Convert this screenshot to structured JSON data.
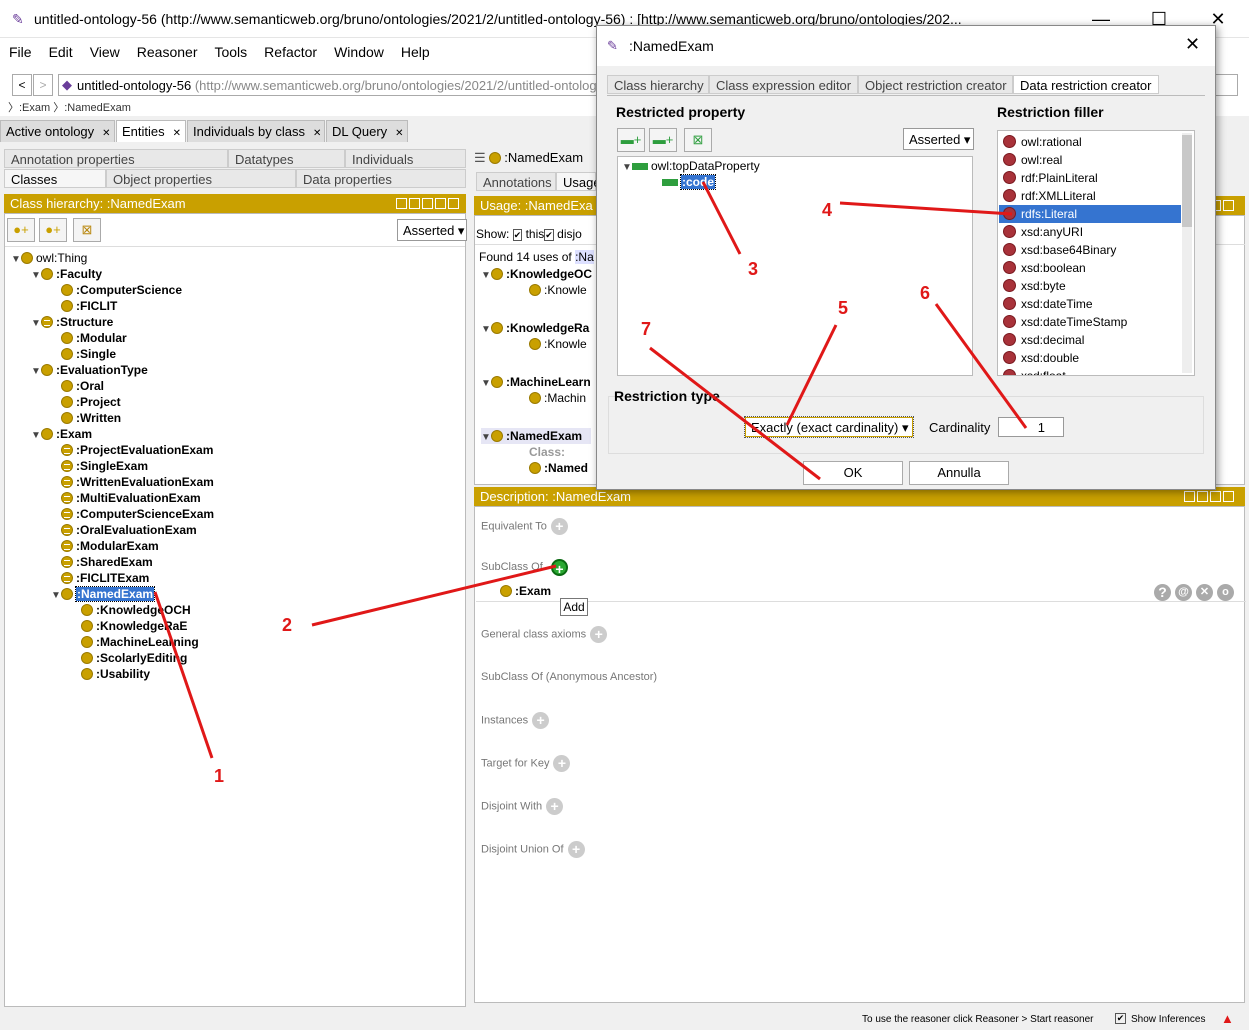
{
  "main_window": {
    "title": "untitled-ontology-56 (http://www.semanticweb.org/bruno/ontologies/2021/2/untitled-ontology-56)  : [http://www.semanticweb.org/bruno/ontologies/202...",
    "menu": [
      "File",
      "Edit",
      "View",
      "Reasoner",
      "Tools",
      "Refactor",
      "Window",
      "Help"
    ],
    "address": {
      "name": "untitled-ontology-56",
      "iri": "(http://www.semanticweb.org/bruno/ontologies/2021/2/untitled-ontolog"
    },
    "breadcrumb": [
      ":Exam",
      ":NamedExam"
    ],
    "tabs": [
      "Active ontology",
      "Entities",
      "Individuals by class",
      "DL Query"
    ]
  },
  "left": {
    "subtabs_row1": [
      "Annotation properties",
      "Datatypes",
      "Individuals"
    ],
    "subtabs_row2": [
      "Classes",
      "Object properties",
      "Data properties"
    ],
    "hierarchy_title": "Class hierarchy: :NamedExam",
    "asserted": "Asserted",
    "tree": [
      {
        "label": "owl:Thing",
        "bold": false
      },
      {
        "label": ":Faculty",
        "bold": true
      },
      {
        "label": ":ComputerScience",
        "bold": true
      },
      {
        "label": ":FICLIT",
        "bold": true
      },
      {
        "label": ":Structure",
        "bold": true
      },
      {
        "label": ":Modular",
        "bold": true
      },
      {
        "label": ":Single",
        "bold": true
      },
      {
        "label": ":EvaluationType",
        "bold": true
      },
      {
        "label": ":Oral",
        "bold": true
      },
      {
        "label": ":Project",
        "bold": true
      },
      {
        "label": ":Written",
        "bold": true
      },
      {
        "label": ":Exam",
        "bold": true
      },
      {
        "label": ":ProjectEvaluationExam",
        "bold": true
      },
      {
        "label": ":SingleExam",
        "bold": true
      },
      {
        "label": ":WrittenEvaluationExam",
        "bold": true
      },
      {
        "label": ":MultiEvaluationExam",
        "bold": true
      },
      {
        "label": ":ComputerScienceExam",
        "bold": true
      },
      {
        "label": ":OralEvaluationExam",
        "bold": true
      },
      {
        "label": ":ModularExam",
        "bold": true
      },
      {
        "label": ":SharedExam",
        "bold": true
      },
      {
        "label": ":FICLITExam",
        "bold": true
      },
      {
        "label": ":NamedExam",
        "bold": true
      },
      {
        "label": ":KnowledgeOCH",
        "bold": true
      },
      {
        "label": ":KnowledgeRaE",
        "bold": true
      },
      {
        "label": ":MachineLearning",
        "bold": true
      },
      {
        "label": ":ScolarlyEditing",
        "bold": true
      },
      {
        "label": ":Usability",
        "bold": true
      }
    ]
  },
  "right": {
    "entity_header": ":NamedExam",
    "tabs": [
      "Annotations",
      "Usage"
    ],
    "usage_title": "Usage: :NamedExa",
    "show_label": "Show:",
    "show_this": "this",
    "show_disj": "disjo",
    "found": "Found 14 uses of",
    "found_entity": ":Na",
    "usage_rows": [
      ":KnowledgeOC",
      ":Knowle",
      ":KnowledgeRa",
      ":Knowle",
      ":MachineLearn",
      ":Machin",
      ":NamedExam",
      "Class:",
      ":Named"
    ],
    "description_title": "Description: :NamedExam",
    "sections": [
      "Equivalent To",
      "SubClass Of",
      "General class axioms",
      "SubClass Of (Anonymous Ancestor)",
      "Instances",
      "Target for Key",
      "Disjoint With",
      "Disjoint Union Of"
    ],
    "subclass_value": ":Exam",
    "tooltip": "Add"
  },
  "dialog": {
    "title": ":NamedExam",
    "tabs": [
      "Class hierarchy",
      "Class expression editor",
      "Object restriction creator",
      "Data restriction creator"
    ],
    "restricted_property_label": "Restricted property",
    "asserted": "Asserted",
    "prop_root": "owl:topDataProperty",
    "prop_child": ":code",
    "filler_label": "Restriction filler",
    "fillers": [
      "owl:rational",
      "owl:real",
      "rdf:PlainLiteral",
      "rdf:XMLLiteral",
      "rdfs:Literal",
      "xsd:anyURI",
      "xsd:base64Binary",
      "xsd:boolean",
      "xsd:byte",
      "xsd:dateTime",
      "xsd:dateTimeStamp",
      "xsd:decimal",
      "xsd:double",
      "xsd:float"
    ],
    "selected_filler": "rdfs:Literal",
    "restriction_type_label": "Restriction type",
    "restriction_type": "Exactly (exact cardinality)",
    "cardinality_label": "Cardinality",
    "cardinality": "1",
    "ok": "OK",
    "cancel": "Annulla"
  },
  "annotations": [
    "1",
    "2",
    "3",
    "4",
    "5",
    "6",
    "7"
  ],
  "status": {
    "text": "To use the reasoner click Reasoner > Start reasoner",
    "show_inferences": "Show Inferences"
  },
  "colors": {
    "gold": "#c9a000",
    "selection": "#3574d0",
    "annotation_red": "#e01818",
    "datatype_red": "#a8323a",
    "data_property_green": "#2e9e3e"
  }
}
